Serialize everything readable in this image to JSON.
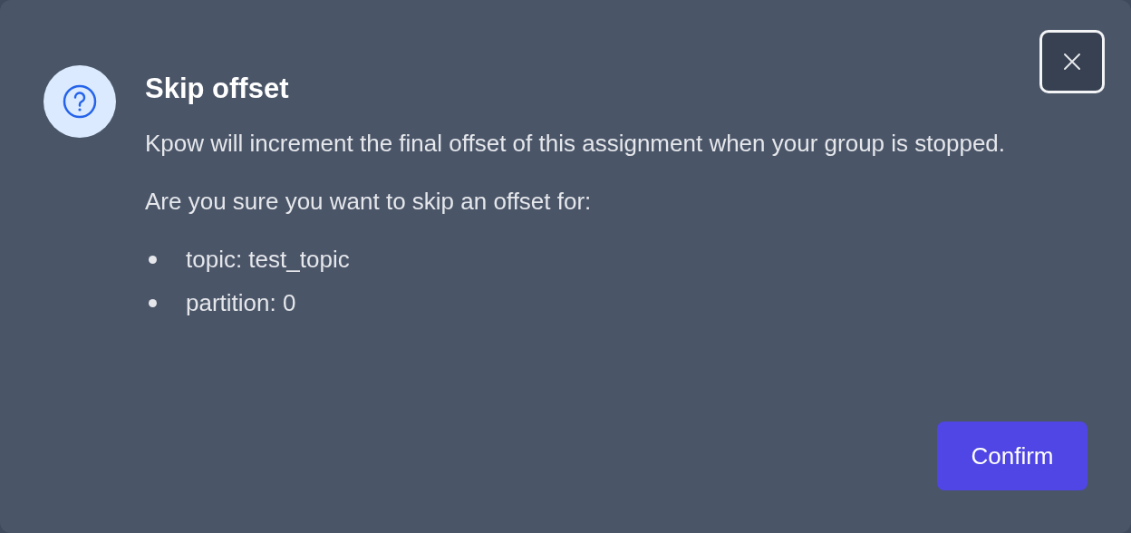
{
  "dialog": {
    "title": "Skip offset",
    "message": "Kpow will increment the final offset of this assignment when your group is stopped.",
    "question": "Are you sure you want to skip an offset for:",
    "items": [
      {
        "text": "topic: test_topic"
      },
      {
        "text": "partition: 0"
      }
    ],
    "confirm_button": "Confirm"
  }
}
